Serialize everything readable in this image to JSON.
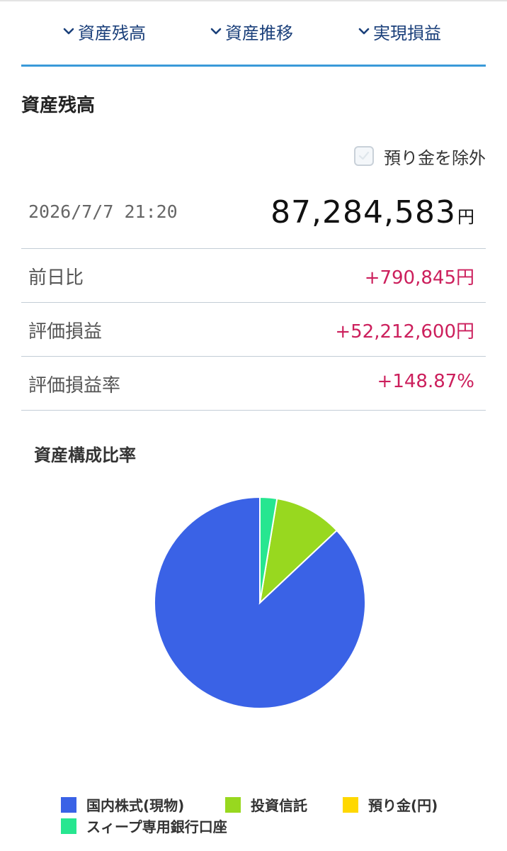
{
  "tabs": [
    {
      "label": "資産残高"
    },
    {
      "label": "資産推移"
    },
    {
      "label": "実現損益"
    }
  ],
  "section_title": "資産残高",
  "exclude_deposit": {
    "label": "預り金を除外",
    "checked": false
  },
  "balance": {
    "datetime": "2026/7/7 21:20",
    "amount": "87,284,583",
    "unit": "円"
  },
  "stats": [
    {
      "label": "前日比",
      "value": "+790,845円"
    },
    {
      "label": "評価損益",
      "value": "+52,212,600円"
    },
    {
      "label": "評価損益率",
      "value": "+148.87%"
    }
  ],
  "colors": {
    "accent_line": "#3a9ad9",
    "tab_text": "#1a3f7a",
    "positive": "#cc1f5c"
  },
  "chart_data": {
    "type": "pie",
    "title": "資産構成比率",
    "slices": [
      {
        "name": "国内株式(現物)",
        "value": 87.0,
        "color": "#3a62e6"
      },
      {
        "name": "投資信託",
        "value": 10.4,
        "color": "#98d81f"
      },
      {
        "name": "預り金(円)",
        "value": 0.0,
        "color": "#ffd800"
      },
      {
        "name": "スィープ専用銀行口座",
        "value": 2.6,
        "color": "#27e690"
      }
    ],
    "legend_position": "bottom"
  }
}
